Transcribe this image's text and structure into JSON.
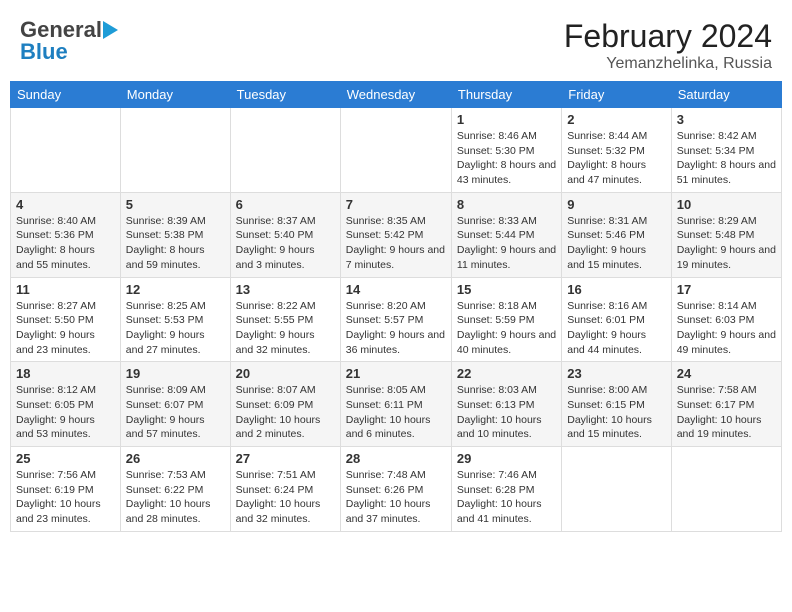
{
  "header": {
    "logo_general": "General",
    "logo_blue": "Blue",
    "month_year": "February 2024",
    "location": "Yemanzhelinka, Russia"
  },
  "days_of_week": [
    "Sunday",
    "Monday",
    "Tuesday",
    "Wednesday",
    "Thursday",
    "Friday",
    "Saturday"
  ],
  "weeks": [
    [
      {
        "day": "",
        "info": ""
      },
      {
        "day": "",
        "info": ""
      },
      {
        "day": "",
        "info": ""
      },
      {
        "day": "",
        "info": ""
      },
      {
        "day": "1",
        "info": "Sunrise: 8:46 AM\nSunset: 5:30 PM\nDaylight: 8 hours and 43 minutes."
      },
      {
        "day": "2",
        "info": "Sunrise: 8:44 AM\nSunset: 5:32 PM\nDaylight: 8 hours and 47 minutes."
      },
      {
        "day": "3",
        "info": "Sunrise: 8:42 AM\nSunset: 5:34 PM\nDaylight: 8 hours and 51 minutes."
      }
    ],
    [
      {
        "day": "4",
        "info": "Sunrise: 8:40 AM\nSunset: 5:36 PM\nDaylight: 8 hours and 55 minutes."
      },
      {
        "day": "5",
        "info": "Sunrise: 8:39 AM\nSunset: 5:38 PM\nDaylight: 8 hours and 59 minutes."
      },
      {
        "day": "6",
        "info": "Sunrise: 8:37 AM\nSunset: 5:40 PM\nDaylight: 9 hours and 3 minutes."
      },
      {
        "day": "7",
        "info": "Sunrise: 8:35 AM\nSunset: 5:42 PM\nDaylight: 9 hours and 7 minutes."
      },
      {
        "day": "8",
        "info": "Sunrise: 8:33 AM\nSunset: 5:44 PM\nDaylight: 9 hours and 11 minutes."
      },
      {
        "day": "9",
        "info": "Sunrise: 8:31 AM\nSunset: 5:46 PM\nDaylight: 9 hours and 15 minutes."
      },
      {
        "day": "10",
        "info": "Sunrise: 8:29 AM\nSunset: 5:48 PM\nDaylight: 9 hours and 19 minutes."
      }
    ],
    [
      {
        "day": "11",
        "info": "Sunrise: 8:27 AM\nSunset: 5:50 PM\nDaylight: 9 hours and 23 minutes."
      },
      {
        "day": "12",
        "info": "Sunrise: 8:25 AM\nSunset: 5:53 PM\nDaylight: 9 hours and 27 minutes."
      },
      {
        "day": "13",
        "info": "Sunrise: 8:22 AM\nSunset: 5:55 PM\nDaylight: 9 hours and 32 minutes."
      },
      {
        "day": "14",
        "info": "Sunrise: 8:20 AM\nSunset: 5:57 PM\nDaylight: 9 hours and 36 minutes."
      },
      {
        "day": "15",
        "info": "Sunrise: 8:18 AM\nSunset: 5:59 PM\nDaylight: 9 hours and 40 minutes."
      },
      {
        "day": "16",
        "info": "Sunrise: 8:16 AM\nSunset: 6:01 PM\nDaylight: 9 hours and 44 minutes."
      },
      {
        "day": "17",
        "info": "Sunrise: 8:14 AM\nSunset: 6:03 PM\nDaylight: 9 hours and 49 minutes."
      }
    ],
    [
      {
        "day": "18",
        "info": "Sunrise: 8:12 AM\nSunset: 6:05 PM\nDaylight: 9 hours and 53 minutes."
      },
      {
        "day": "19",
        "info": "Sunrise: 8:09 AM\nSunset: 6:07 PM\nDaylight: 9 hours and 57 minutes."
      },
      {
        "day": "20",
        "info": "Sunrise: 8:07 AM\nSunset: 6:09 PM\nDaylight: 10 hours and 2 minutes."
      },
      {
        "day": "21",
        "info": "Sunrise: 8:05 AM\nSunset: 6:11 PM\nDaylight: 10 hours and 6 minutes."
      },
      {
        "day": "22",
        "info": "Sunrise: 8:03 AM\nSunset: 6:13 PM\nDaylight: 10 hours and 10 minutes."
      },
      {
        "day": "23",
        "info": "Sunrise: 8:00 AM\nSunset: 6:15 PM\nDaylight: 10 hours and 15 minutes."
      },
      {
        "day": "24",
        "info": "Sunrise: 7:58 AM\nSunset: 6:17 PM\nDaylight: 10 hours and 19 minutes."
      }
    ],
    [
      {
        "day": "25",
        "info": "Sunrise: 7:56 AM\nSunset: 6:19 PM\nDaylight: 10 hours and 23 minutes."
      },
      {
        "day": "26",
        "info": "Sunrise: 7:53 AM\nSunset: 6:22 PM\nDaylight: 10 hours and 28 minutes."
      },
      {
        "day": "27",
        "info": "Sunrise: 7:51 AM\nSunset: 6:24 PM\nDaylight: 10 hours and 32 minutes."
      },
      {
        "day": "28",
        "info": "Sunrise: 7:48 AM\nSunset: 6:26 PM\nDaylight: 10 hours and 37 minutes."
      },
      {
        "day": "29",
        "info": "Sunrise: 7:46 AM\nSunset: 6:28 PM\nDaylight: 10 hours and 41 minutes."
      },
      {
        "day": "",
        "info": ""
      },
      {
        "day": "",
        "info": ""
      }
    ]
  ]
}
